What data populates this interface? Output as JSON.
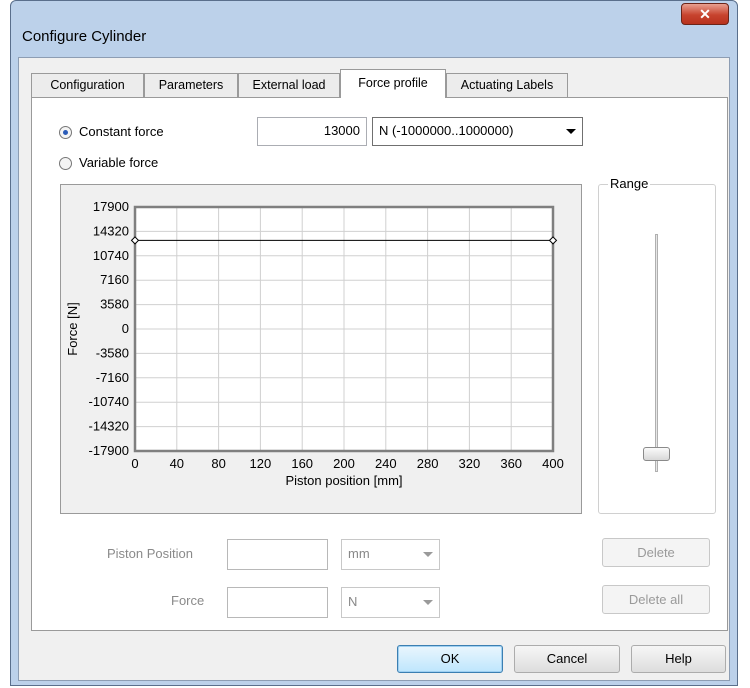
{
  "window": {
    "title": "Configure Cylinder",
    "close_icon": "close-icon"
  },
  "tabs": [
    {
      "label": "Configuration"
    },
    {
      "label": "Parameters"
    },
    {
      "label": "External load"
    },
    {
      "label": "Force profile"
    },
    {
      "label": "Actuating Labels"
    }
  ],
  "active_tab": "Force profile",
  "force": {
    "constant_label": "Constant force",
    "variable_label": "Variable force",
    "selected": "Constant force",
    "value": "13000",
    "unit": "N  (-1000000..1000000)"
  },
  "chart_data": {
    "type": "line",
    "xlabel": "Piston position [mm]",
    "ylabel": "Force [N]",
    "xlim": [
      0,
      400
    ],
    "ylim": [
      -17900,
      17900
    ],
    "x_ticks": [
      "0",
      "40",
      "80",
      "120",
      "160",
      "200",
      "240",
      "280",
      "320",
      "360",
      "400"
    ],
    "y_ticks": [
      "17900",
      "14320",
      "10740",
      "7160",
      "3580",
      "0",
      "-3580",
      "-7160",
      "-10740",
      "-14320",
      "-17900"
    ],
    "grid": true,
    "series": [
      {
        "x": [
          0,
          400
        ],
        "y": [
          13000,
          13000
        ]
      }
    ]
  },
  "range": {
    "label": "Range",
    "slider_position": 0.05
  },
  "piston_position": {
    "label": "Piston Position",
    "value": "",
    "unit": "mm"
  },
  "force_field": {
    "label": "Force",
    "value": "",
    "unit": "N"
  },
  "buttons": {
    "delete": "Delete",
    "delete_all": "Delete all",
    "ok": "OK",
    "cancel": "Cancel",
    "help": "Help"
  }
}
